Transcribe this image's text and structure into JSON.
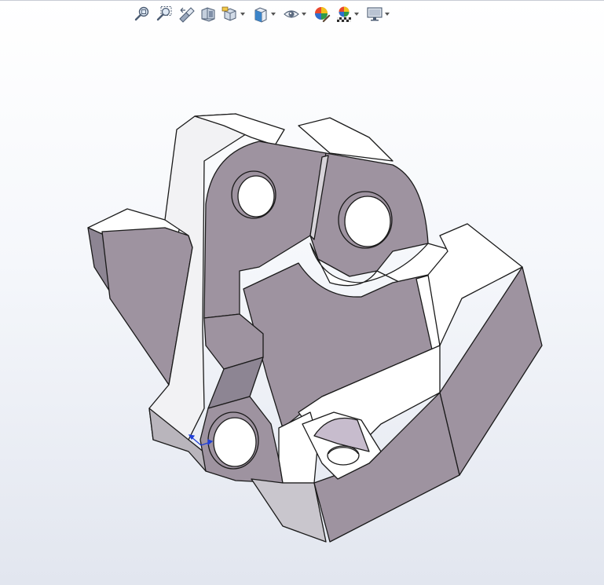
{
  "viewport": {
    "background_top": "#ffffff",
    "background_bottom": "#e2e6ef"
  },
  "heads_up_toolbar": {
    "items": [
      {
        "icon": "zoom-to-fit-icon",
        "has_dropdown": false
      },
      {
        "icon": "zoom-to-area-icon",
        "has_dropdown": false
      },
      {
        "icon": "previous-view-icon",
        "has_dropdown": false
      },
      {
        "icon": "section-view-icon",
        "has_dropdown": false
      },
      {
        "icon": "dynamic-annotation-view-icon",
        "has_dropdown": true
      },
      {
        "icon": "view-orientation-icon",
        "has_dropdown": true
      },
      {
        "icon": "hide-show-items-icon",
        "has_dropdown": true
      },
      {
        "icon": "edit-appearance-icon",
        "has_dropdown": false
      },
      {
        "icon": "apply-scene-icon",
        "has_dropdown": true
      },
      {
        "icon": "view-settings-icon",
        "has_dropdown": true
      }
    ]
  },
  "model": {
    "face_color": "#9e93a0",
    "edge_color": "#1a1a1a",
    "highlight_color": "#ffffff",
    "triad_color": "#1f3fd8"
  }
}
